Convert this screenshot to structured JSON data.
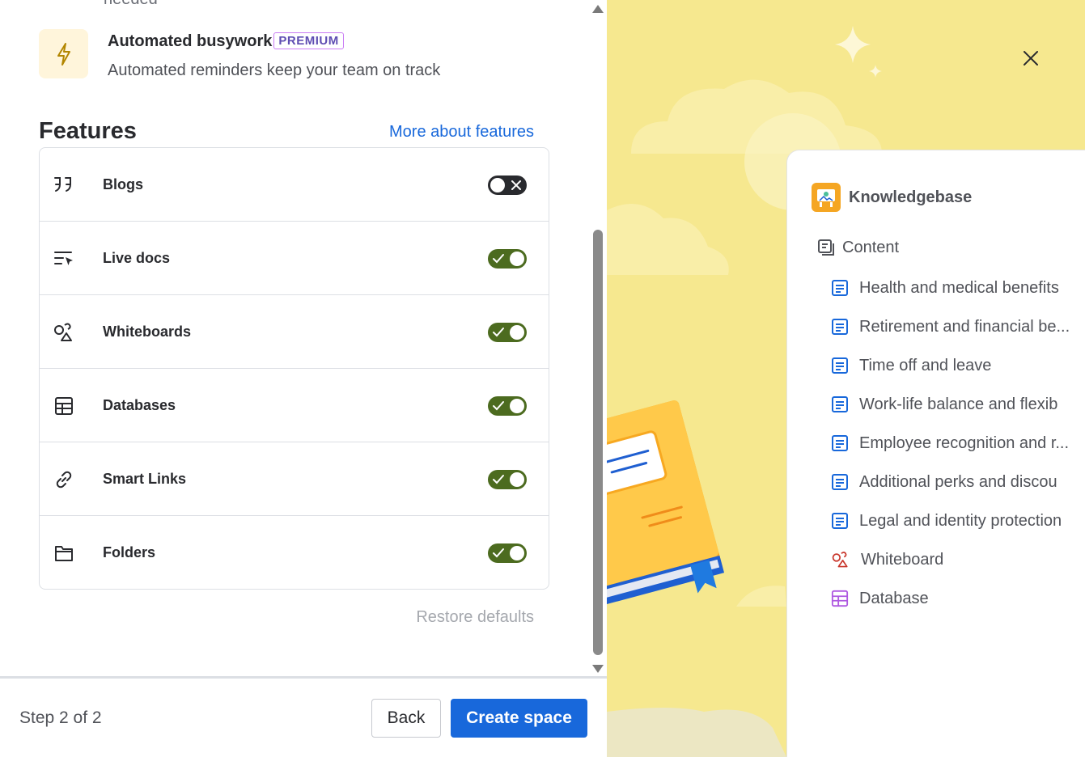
{
  "top_cut_text": "needed",
  "automation": {
    "title": "Automated busywork",
    "badge": "PREMIUM",
    "description": "Automated reminders keep your team on track"
  },
  "features": {
    "heading": "Features",
    "more_link": "More about features",
    "items": [
      {
        "label": "Blogs",
        "icon": "quote-icon",
        "enabled": false
      },
      {
        "label": "Live docs",
        "icon": "live-doc-icon",
        "enabled": true
      },
      {
        "label": "Whiteboards",
        "icon": "whiteboard-icon",
        "enabled": true
      },
      {
        "label": "Databases",
        "icon": "database-icon",
        "enabled": true
      },
      {
        "label": "Smart Links",
        "icon": "link-icon",
        "enabled": true
      },
      {
        "label": "Folders",
        "icon": "folder-icon",
        "enabled": true
      }
    ],
    "restore_label": "Restore defaults"
  },
  "footer": {
    "step": "Step 2 of 2",
    "back_label": "Back",
    "create_label": "Create space"
  },
  "preview": {
    "space_name": "Knowledgebase",
    "content_label": "Content",
    "pages": [
      {
        "label": "Health and medical benefits",
        "type": "page"
      },
      {
        "label": "Retirement and financial be...",
        "type": "page"
      },
      {
        "label": "Time off and leave",
        "type": "page"
      },
      {
        "label": "Work-life balance and flexib",
        "type": "page"
      },
      {
        "label": "Employee recognition and r...",
        "type": "page"
      },
      {
        "label": "Additional perks and discou",
        "type": "page"
      },
      {
        "label": "Legal and identity protection",
        "type": "page"
      },
      {
        "label": "Whiteboard",
        "type": "whiteboard"
      },
      {
        "label": "Database",
        "type": "database"
      }
    ]
  },
  "colors": {
    "accent": "#1868db",
    "toggle_on": "#4c6b1f",
    "toggle_off": "#292a2e",
    "preview_bg": "#f6e88f"
  }
}
